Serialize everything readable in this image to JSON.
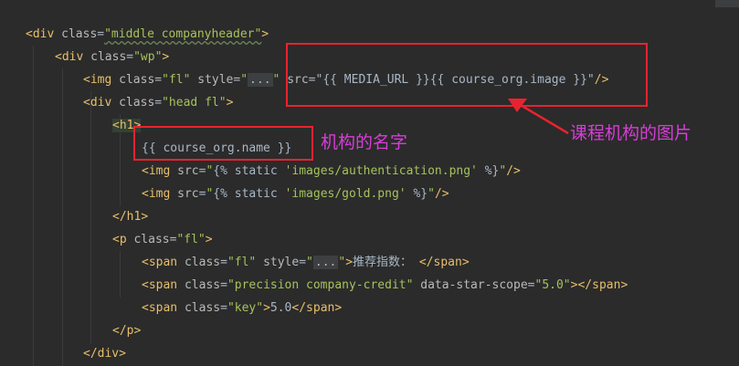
{
  "code_lines": {
    "l1": {
      "lt": "<",
      "tag": "div",
      "sp": " ",
      "attr": "class",
      "eq": "=",
      "val": "\"middle companyheader\"",
      "gt": ">"
    },
    "l2": {
      "lt": "<",
      "tag": "div",
      "sp": " ",
      "attr": "class",
      "eq": "=",
      "val": "\"wp\"",
      "gt": ">"
    },
    "l3": {
      "lt": "<",
      "tag": "img",
      "sp": " ",
      "attr1": "class",
      "eq": "=",
      "val1": "\"fl\"",
      "sp2": " ",
      "attr2": "style",
      "q1": "\"",
      "fold": "...",
      "q2": "\"",
      "sp3": " ",
      "attr3": "src",
      "val3a": "\"{{ MEDIA_URL }}{{ course_org.image }}\"",
      "end": "/>"
    },
    "l4": {
      "lt": "<",
      "tag": "div",
      "sp": " ",
      "attr": "class",
      "eq": "=",
      "val": "\"head fl\"",
      "gt": ">"
    },
    "l5": {
      "lt": "<",
      "tag": "h1",
      "gt": ">"
    },
    "l6": {
      "text": "{{ course_org.name }}"
    },
    "l7": {
      "lt": "<",
      "tag": "img",
      "sp": " ",
      "attr": "src",
      "eq": "=",
      "q": "\"",
      "tpl": "{% static ",
      "path": "'images/authentication.png'",
      "tpl_end": " %}",
      "q2": "\"",
      "end": "/>"
    },
    "l8": {
      "lt": "<",
      "tag": "img",
      "sp": " ",
      "attr": "src",
      "eq": "=",
      "q": "\"",
      "tpl": "{% static ",
      "path": "'images/gold.png'",
      "tpl_end": " %}",
      "q2": "\"",
      "end": "/>"
    },
    "l9": {
      "lt": "</",
      "tag": "h1",
      "gt": ">"
    },
    "l10": {
      "lt": "<",
      "tag": "p",
      "sp": " ",
      "attr": "class",
      "eq": "=",
      "val": "\"fl\"",
      "gt": ">"
    },
    "l11": {
      "lt": "<",
      "tag": "span",
      "sp": " ",
      "attr1": "class",
      "eq": "=",
      "val1": "\"fl\"",
      "sp2": " ",
      "attr2": "style",
      "q1": "\"",
      "fold": "...",
      "q2": "\"",
      "gt": ">",
      "text": "推荐指数： ",
      "close_lt": "</",
      "close_tag": "span",
      "close_gt": ">"
    },
    "l12": {
      "lt": "<",
      "tag": "span",
      "sp": " ",
      "attr1": "class",
      "eq": "=",
      "val1": "\"precision company-credit\"",
      "sp2": " ",
      "attr2": "data-star-scope",
      "eq2": "=",
      "val2": "\"5.0\"",
      "gt": ">",
      "close_lt": "</",
      "close_tag": "span",
      "close_gt": ">"
    },
    "l13": {
      "lt": "<",
      "tag": "span",
      "sp": " ",
      "attr": "class",
      "eq": "=",
      "val": "\"key\"",
      "gt": ">",
      "text": "5.0",
      "close_lt": "</",
      "close_tag": "span",
      "close_gt": ">"
    },
    "l14": {
      "lt": "</",
      "tag": "p",
      "gt": ">"
    },
    "l15": {
      "lt": "</",
      "tag": "div",
      "gt": ">"
    }
  },
  "annotations": {
    "org_name": "机构的名字",
    "org_image": "课程机构的图片"
  },
  "colors": {
    "background": "#2b2b2b",
    "tag": "#e8bf6a",
    "attribute": "#bababa",
    "string_value": "#a5c25c",
    "text": "#a9b7c6",
    "annotation_box": "#e8232f",
    "annotation_text": "#d63ed6"
  }
}
